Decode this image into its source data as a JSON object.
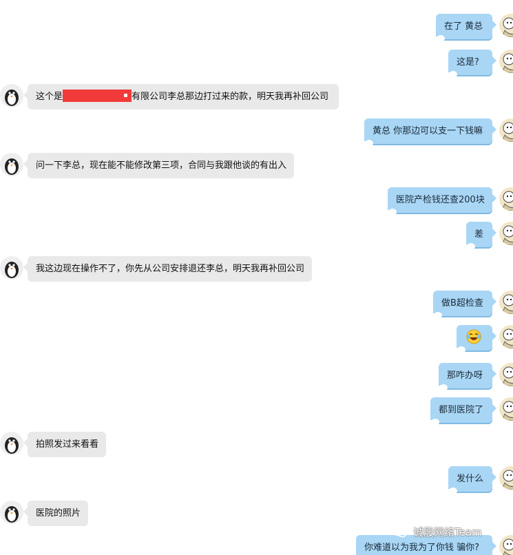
{
  "messages": [
    {
      "side": "right",
      "text": "在了 黄总"
    },
    {
      "side": "right",
      "text": "这是?"
    },
    {
      "side": "left",
      "text_before": "这个是",
      "text_after": "有限公司李总那边打过来的款，明天我再补回公司"
    },
    {
      "side": "right",
      "text": "黄总 你那边可以支一下钱嘛"
    },
    {
      "side": "left",
      "text": "问一下李总，现在能不能修改第三项，合同与我跟他谈的有出入"
    },
    {
      "side": "right",
      "text": "医院产检钱还查200块"
    },
    {
      "side": "right",
      "text": "差"
    },
    {
      "side": "left",
      "text": "我这边现在操作不了，你先从公司安排退还李总，明天我再补回公司"
    },
    {
      "side": "right",
      "text": "做B超检查"
    },
    {
      "side": "right",
      "emoji": "crying-laughing-face-icon"
    },
    {
      "side": "right",
      "text": "那咋办呀"
    },
    {
      "side": "right",
      "text": "都到医院了"
    },
    {
      "side": "left",
      "text": "拍照发过来看看"
    },
    {
      "side": "right",
      "text": "发什么"
    },
    {
      "side": "left",
      "text": "医院的照片"
    },
    {
      "side": "right",
      "text": "你难道以为我为了你钱 骗你?"
    }
  ],
  "watermark": {
    "text": "诚殷网络Team",
    "icon": "wechat-icon"
  },
  "colors": {
    "incoming_bubble": "#e9e9e9",
    "outgoing_bubble": "#a9d6f5",
    "redaction": "#f23a3a"
  }
}
